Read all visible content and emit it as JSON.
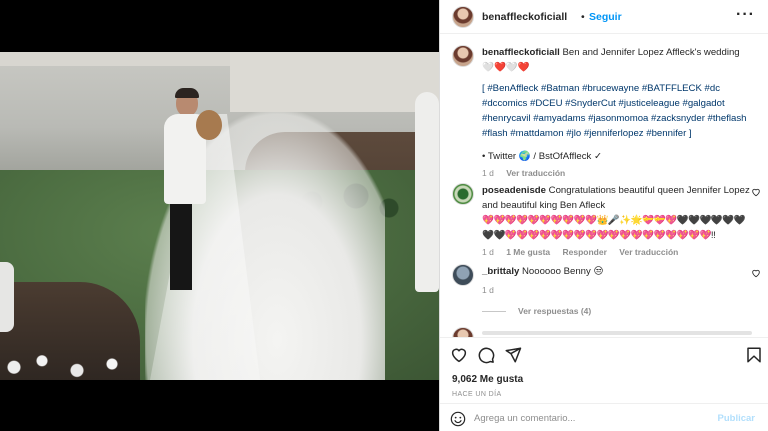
{
  "post": {
    "author": "benaffleckoficiall",
    "dot": "•",
    "follow_label": "Seguir",
    "more_label": "···"
  },
  "caption": {
    "username": "benaffleckoficiall",
    "text": "Ben and Jennifer Lopez Affleck's wedding",
    "hearts": "🤍❤️🤍❤️",
    "tags": "[ #BenAffleck #Batman #brucewayne #BATFFLECK #dc #dccomics #DCEU #SnyderCut #justiceleague #galgadot #henrycavil #amyadams #jasonmomoa #zacksnyder #theflash #flash #mattdamon #jlo #jenniferlopez #bennifer ]",
    "source": "• Twitter 🌍 / BstOfAffleck ✓",
    "time": "1 d",
    "translate": "Ver traducción"
  },
  "comments": [
    {
      "username": "poseadenisde",
      "text": "Congratulations beautiful queen Jennifer Lopez and beautiful king Ben Afleck",
      "emojis": "💖💖💖💖💖💖💖💖💖💖👑🎤✨🌟💝💝💖🖤🖤🖤🖤🖤🖤🖤🖤💖💖💖💖💖💖💖💖💖💖💖💖💖💖💖💖💖💖!!",
      "time": "1 d",
      "likes": "1 Me gusta",
      "reply": "Responder",
      "translate": "Ver traducción"
    },
    {
      "username": "_brittaly",
      "text": "Noooooo Benny 😒",
      "time": "1 d",
      "view_replies": "Ver respuestas (4)"
    }
  ],
  "likes": "9,062 Me gusta",
  "date": "HACE UN DÍA",
  "composer": {
    "placeholder": "Agrega un comentario...",
    "publish_label": "Publicar"
  },
  "icons": {
    "like": "heart-icon",
    "comment": "comment-icon",
    "share": "share-icon",
    "save": "bookmark-icon",
    "emoji": "emoji-icon"
  },
  "colors": {
    "link": "#0095f6",
    "hashtag": "#00376b",
    "muted": "#8e8e8e",
    "publish_disabled": "#b2dffc"
  }
}
